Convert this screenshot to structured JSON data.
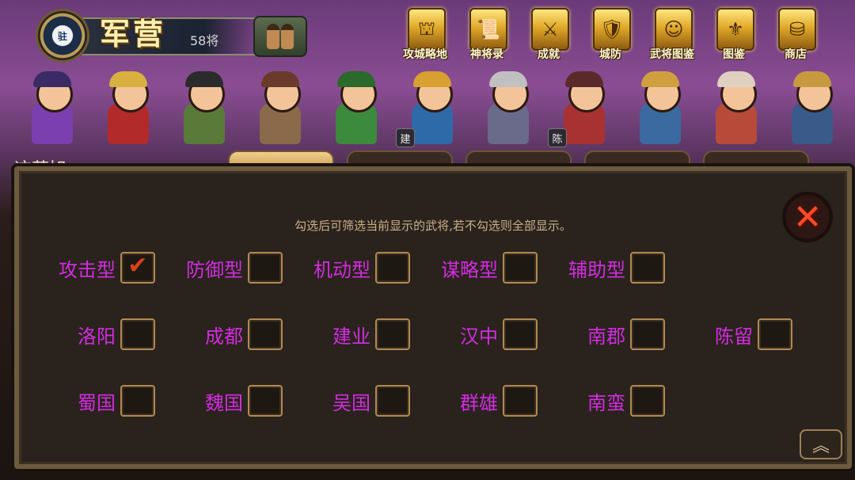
{
  "header": {
    "badge_text": "驻",
    "title": "军营",
    "count": "58将"
  },
  "menu": [
    {
      "label": "攻城略地",
      "icon": "castle-icon"
    },
    {
      "label": "神将录",
      "icon": "scroll-book-icon"
    },
    {
      "label": "成就",
      "icon": "achievement-medal-icon"
    },
    {
      "label": "城防",
      "icon": "shield-icon"
    },
    {
      "label": "武将图鉴",
      "icon": "general-portrait-icon"
    },
    {
      "label": "图鉴",
      "icon": "armor-icon"
    },
    {
      "label": "商店",
      "icon": "treasure-chest-icon"
    }
  ],
  "heroes": [
    {
      "tag": "",
      "color": "#7b3fb0",
      "helm": "#3a2a66"
    },
    {
      "tag": "",
      "color": "#b32a2a",
      "helm": "#d8b040"
    },
    {
      "tag": "",
      "color": "#5a7a3a",
      "helm": "#2b2b2b"
    },
    {
      "tag": "",
      "color": "#8a6a4a",
      "helm": "#6a3a2a"
    },
    {
      "tag": "",
      "color": "#3c8a3c",
      "helm": "#2a6a2a"
    },
    {
      "tag": "建",
      "color": "#2e6aa8",
      "helm": "#d8a030"
    },
    {
      "tag": "",
      "color": "#6a6a8a",
      "helm": "#c0c0c0"
    },
    {
      "tag": "陈",
      "color": "#a83232",
      "helm": "#5a2a2a"
    },
    {
      "tag": "",
      "color": "#3a6aa0",
      "helm": "#d0a040"
    },
    {
      "tag": "",
      "color": "#b84a3a",
      "helm": "#e0d0c0"
    },
    {
      "tag": "",
      "color": "#3a5a8a",
      "helm": "#c89a40"
    }
  ],
  "side_label": "这营旭",
  "dialog": {
    "hint": "勾选后可筛选当前显示的武将,若不勾选则全部显示。",
    "close_icon": "close-x-icon",
    "types": [
      {
        "label": "攻击型",
        "checked": true
      },
      {
        "label": "防御型",
        "checked": false
      },
      {
        "label": "机动型",
        "checked": false
      },
      {
        "label": "谋略型",
        "checked": false
      },
      {
        "label": "辅助型",
        "checked": false
      }
    ],
    "cities": [
      {
        "label": "洛阳",
        "checked": false
      },
      {
        "label": "成都",
        "checked": false
      },
      {
        "label": "建业",
        "checked": false
      },
      {
        "label": "汉中",
        "checked": false
      },
      {
        "label": "南郡",
        "checked": false
      },
      {
        "label": "陈留",
        "checked": false
      }
    ],
    "factions": [
      {
        "label": "蜀国",
        "checked": false
      },
      {
        "label": "魏国",
        "checked": false
      },
      {
        "label": "吴国",
        "checked": false
      },
      {
        "label": "群雄",
        "checked": false
      },
      {
        "label": "南蛮",
        "checked": false
      }
    ],
    "check_mark": "✔",
    "scroll_glyph": "︽"
  }
}
